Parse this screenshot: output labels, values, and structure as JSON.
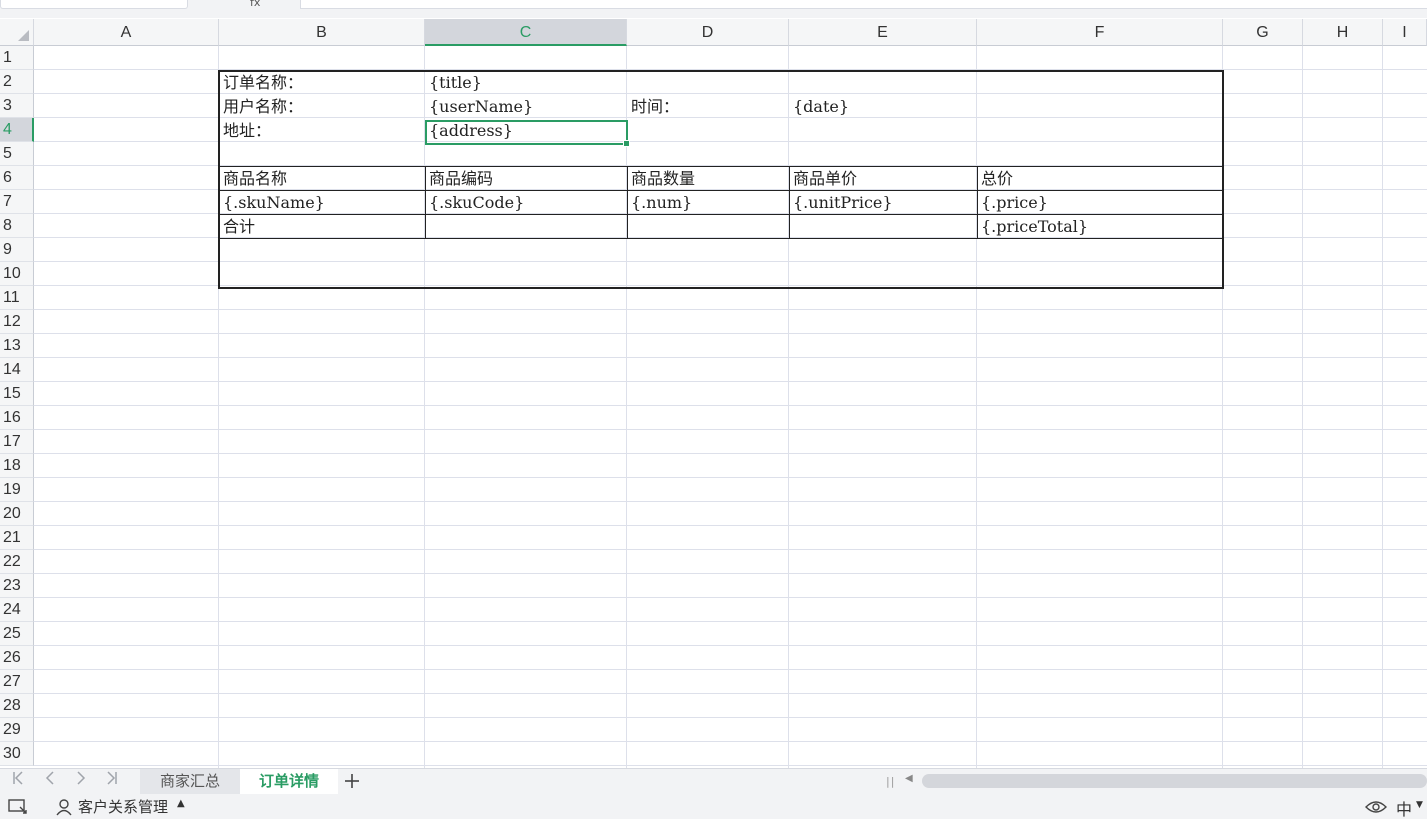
{
  "toolbar": {
    "fx_label": "fx"
  },
  "columns": [
    "A",
    "B",
    "C",
    "D",
    "E",
    "F",
    "G",
    "H",
    "I"
  ],
  "selected_column": "C",
  "rows": [
    "1",
    "2",
    "3",
    "4",
    "5",
    "6",
    "7",
    "8",
    "9",
    "10",
    "11",
    "12",
    "13",
    "14",
    "15",
    "16",
    "17",
    "18",
    "19",
    "20",
    "21",
    "22",
    "23",
    "24",
    "25",
    "26",
    "27",
    "28",
    "29",
    "30"
  ],
  "selected_row": "4",
  "cells": {
    "B2": "订单名称：",
    "C2": "{title}",
    "B3": "用户名称：",
    "C3": "{userName}",
    "D3": "时间：",
    "E3": "{date}",
    "B4": "地址：",
    "C4": "{address}",
    "B6": "商品名称",
    "C6": "商品编码",
    "D6": "商品数量",
    "E6": "商品单价",
    "F6": "总价",
    "B7": "{.skuName}",
    "C7": "{.skuCode}",
    "D7": "{.num}",
    "E7": "{.unitPrice}",
    "F7": "{.price}",
    "B8": "合计",
    "F8": "{.priceTotal}"
  },
  "sheet_tabs": [
    {
      "label": "商家汇总",
      "active": false
    },
    {
      "label": "订单详情",
      "active": true
    }
  ],
  "statusbar": {
    "crm_label": "客户关系管理",
    "lang_label": "中"
  },
  "colors": {
    "accent": "#2a9c64",
    "grid": "#dde0ea",
    "border": "#222222"
  },
  "icons": [
    "first-sheet-icon",
    "prev-sheet-icon",
    "next-sheet-icon",
    "last-sheet-icon",
    "add-sheet-icon",
    "scroll-left-icon",
    "sheet-view-icon",
    "crm-icon",
    "caret-up-icon",
    "eye-icon"
  ]
}
